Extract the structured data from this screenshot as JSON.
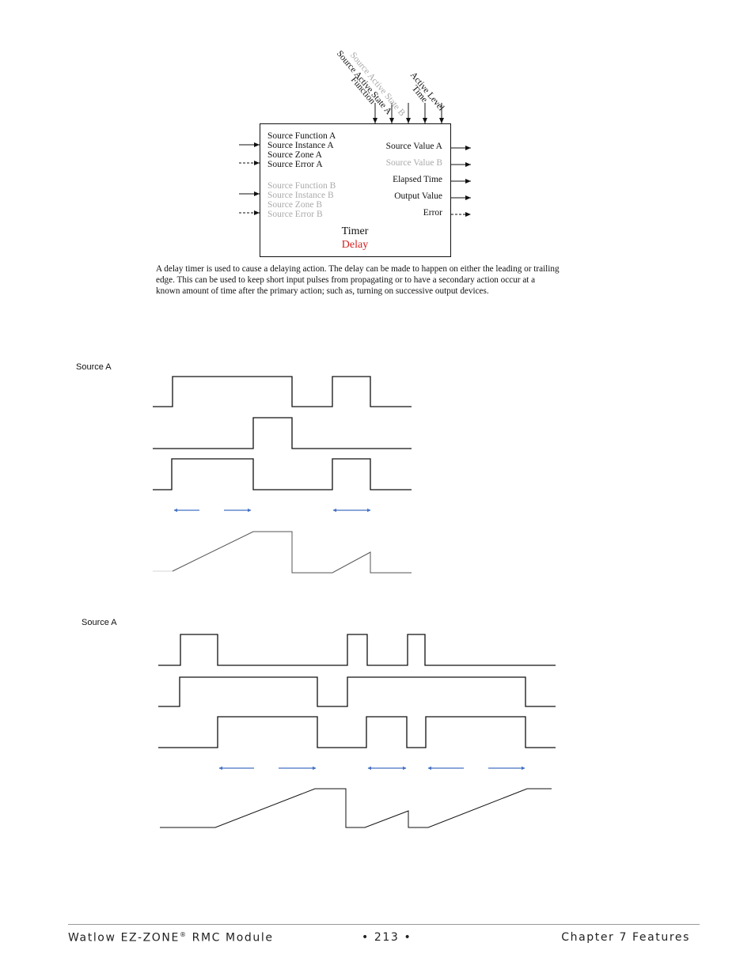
{
  "block": {
    "top_inputs": [
      {
        "label": "Source Active State B",
        "muted": true
      },
      {
        "label": "Source Active State A",
        "muted": false
      },
      {
        "label": "Function",
        "muted": false
      },
      {
        "label": "Active Level",
        "muted": false
      },
      {
        "label": "Time",
        "muted": false
      }
    ],
    "inputs_a": [
      "Source Function A",
      "Source Instance A",
      "Source Zone A",
      "Source Error A"
    ],
    "inputs_b": [
      "Source Function B",
      "Source Instance B",
      "Source Zone B",
      "Source Error B"
    ],
    "outputs": [
      "Source Value A",
      "Source Value B",
      "Elapsed Time",
      "Output Value",
      "Error"
    ],
    "name": "Timer",
    "subname": "Delay",
    "subname_color": "#d42020"
  },
  "description": "A delay timer is used to cause a delaying action.  The delay can be made to happen on either the leading or trailing edge.  This can be used to keep short input pulses from propagating or to have a secondary action occur at a known amount of time after the primary action; such as, turning on successive output devices.",
  "diagram1": {
    "label": "Source A"
  },
  "diagram2": {
    "label": "Source A"
  },
  "arrow_color": "#4472c4",
  "footer": {
    "product": "Watlow EZ-ZONE",
    "reg": "®",
    "module": " RMC Module",
    "page": "•  213  •",
    "chapter": "Chapter 7 Features"
  }
}
